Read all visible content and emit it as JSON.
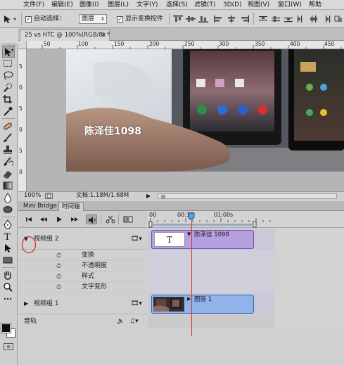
{
  "menu": {
    "items": [
      "文件(F)",
      "编辑(E)",
      "图像(I)",
      "图层(L)",
      "文字(Y)",
      "选择(S)",
      "滤镜(T)",
      "3D(D)",
      "视图(V)",
      "窗口(W)",
      "帮助"
    ]
  },
  "options_bar": {
    "auto_select_label": "自动选择：",
    "auto_select_value": "图层",
    "show_transform_label": "显示变换控件"
  },
  "document": {
    "tab_title": "25 vs HTC @ 100%(RGB/8) *"
  },
  "rulers": {
    "top": [
      "50",
      "100",
      "150",
      "200",
      "250",
      "300",
      "350",
      "400",
      "450"
    ],
    "left": [
      "5",
      "0",
      "5",
      "0",
      "5",
      "0"
    ]
  },
  "canvas": {
    "watermark": "陈泽佳1098"
  },
  "status": {
    "zoom": "100%",
    "doc_info": "文档:1.18M/1.68M"
  },
  "panel": {
    "tabs": [
      "Mini Bridge",
      "时间轴"
    ],
    "time_labels": [
      "00",
      "00:15",
      "01:00s"
    ]
  },
  "timeline": {
    "group2": {
      "name": "视频组 2",
      "properties": [
        "变换",
        "不透明度",
        "样式",
        "文字变形"
      ],
      "clip_label": "陈泽佳 1098",
      "thumb_text": "T",
      "clip_color": "#b7a0e0"
    },
    "group1": {
      "name": "视频组 1",
      "clip_label": "图层 1",
      "clip_color": "#8fb3ea"
    },
    "audio": {
      "name": "音轨"
    }
  },
  "colors": {
    "playhead": "#d23a3a",
    "annotation_circle": "#d93030"
  }
}
